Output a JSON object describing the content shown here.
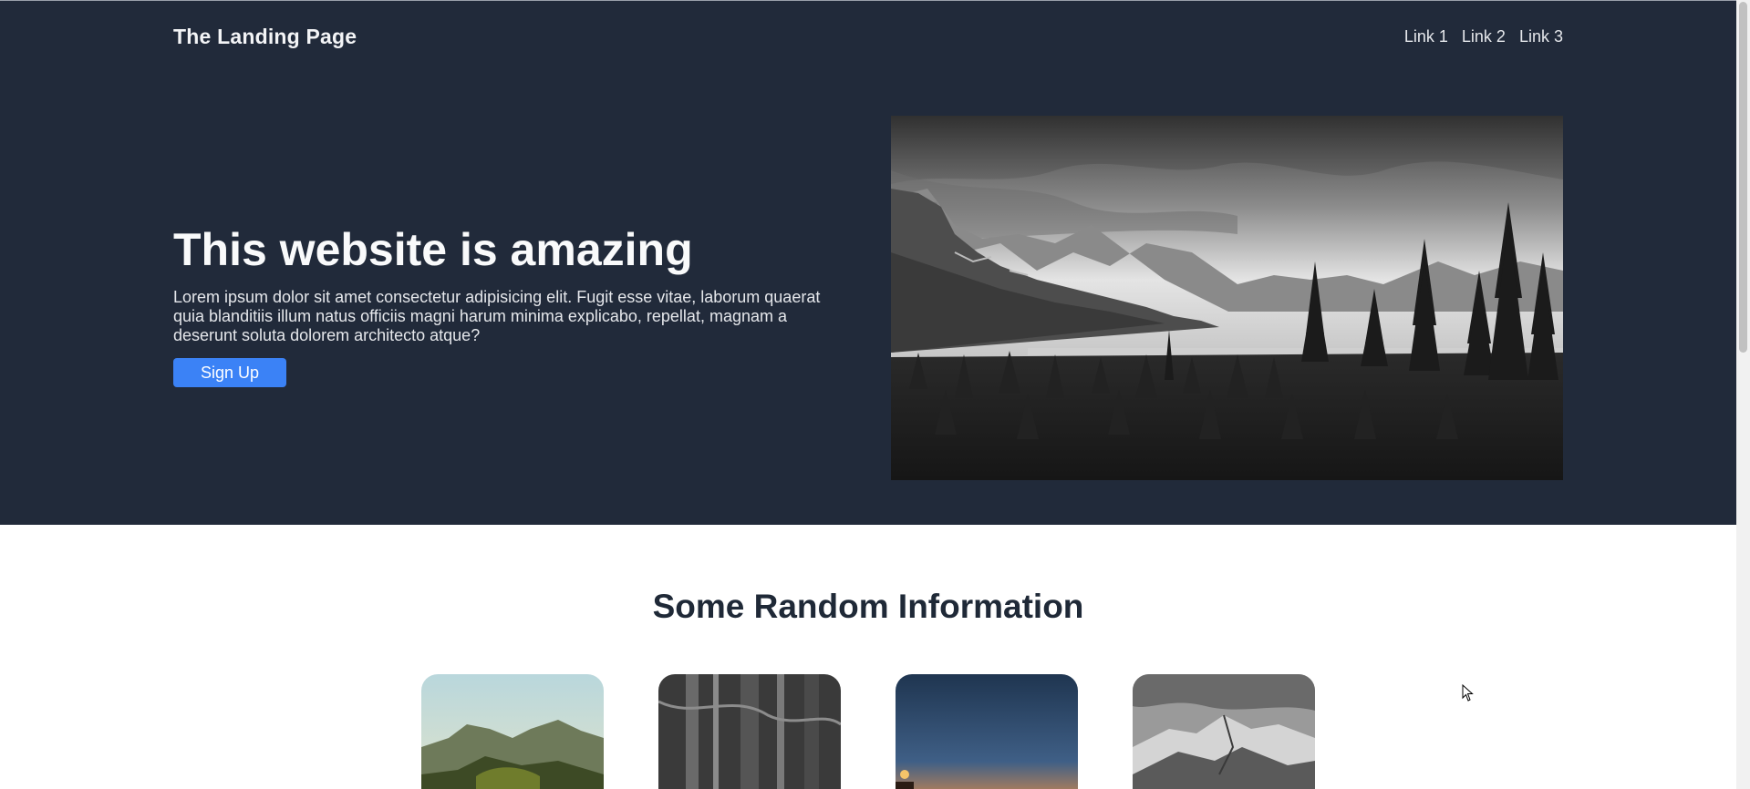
{
  "nav": {
    "brand": "The Landing Page",
    "links": [
      "Link 1",
      "Link 2",
      "Link 3"
    ]
  },
  "hero": {
    "title": "This website is amazing",
    "text": "Lorem ipsum dolor sit amet consectetur adipisicing elit. Fugit esse vitae, laborum quaerat quia blanditiis illum natus officiis magni harum minima explicabo, repellat, magnam a deserunt soluta dolorem architecto atque?",
    "signup_label": "Sign Up"
  },
  "info": {
    "title": "Some Random Information"
  },
  "colors": {
    "hero_background": "#212a3a",
    "accent": "#3b82f6",
    "heading_dark": "#1f2937"
  },
  "icons": {
    "cursor": "mouse-pointer-icon"
  }
}
